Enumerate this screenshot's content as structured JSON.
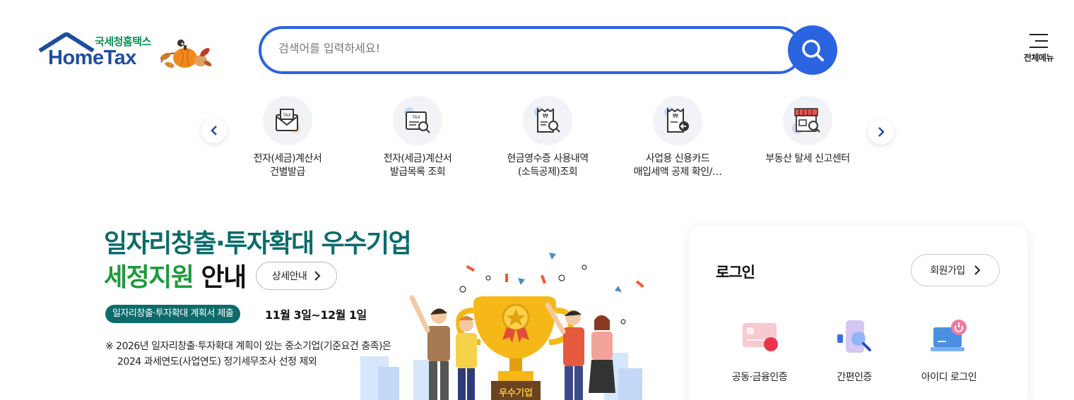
{
  "header": {
    "logo_sub": "국세청홈택스",
    "logo_main": "HomeTax",
    "search_placeholder": "검색어를 입력하세요!",
    "menu_label": "전체메뉴"
  },
  "quick_menu": {
    "items": [
      {
        "label": "전자(세금)계산서\n건별발급",
        "icon": "tax-invoice-mail-icon"
      },
      {
        "label": "전자(세금)계산서\n발급목록 조회",
        "icon": "tax-invoice-search-icon"
      },
      {
        "label": "현금영수증 사용내역\n(소득공제)조회",
        "icon": "cash-receipt-search-icon"
      },
      {
        "label": "사업용 신용카드\n매입세액 공제 확인/…",
        "icon": "card-receipt-icon"
      },
      {
        "label": "부동산 탈세 신고센터",
        "icon": "store-search-icon"
      }
    ]
  },
  "banner": {
    "title_line1": "일자리창출·투자확대 우수기업",
    "title_line2a": "세정지원",
    "title_line2b": " 안내",
    "detail_label": "상세안내",
    "period_badge": "일자리창출·투자확대 계획서 제출",
    "period_date": "11월 3일~12월 1일",
    "notice_line1": "※ 2026년 일자리창출·투자확대 계획이 있는 중소기업(기준요건 충족)은",
    "notice_line2": "2024 과세연도(사업연도) 정기세무조사 선정 제외",
    "trophy_label": "우수기업"
  },
  "login": {
    "title": "로그인",
    "signup_label": "회원가입",
    "options": [
      {
        "label": "공동·금융인증",
        "icon": "certificate-card-icon"
      },
      {
        "label": "간편인증",
        "icon": "phone-auth-icon"
      },
      {
        "label": "아이디 로그인",
        "icon": "laptop-power-icon"
      }
    ]
  },
  "colors": {
    "accent": "#2a64e0",
    "banner_teal": "#0d6b6b",
    "banner_green": "#1e9a3a"
  }
}
